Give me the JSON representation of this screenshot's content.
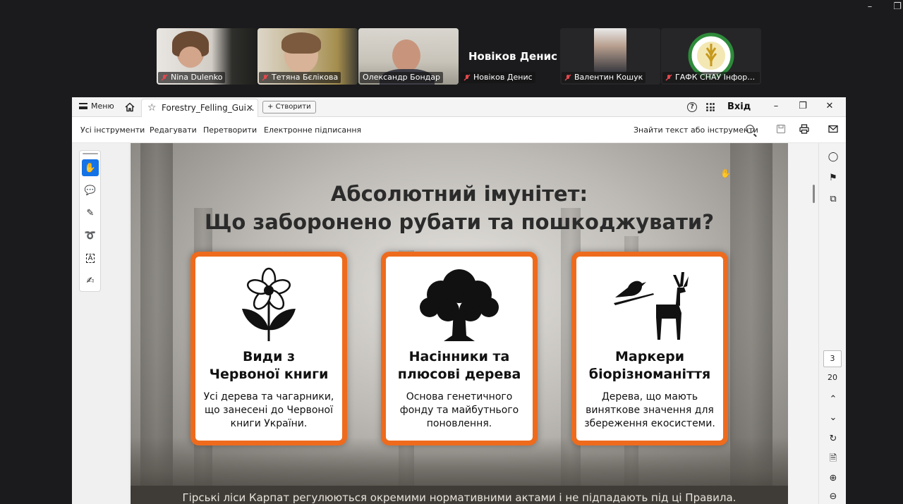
{
  "meeting": {
    "participants": [
      {
        "name": "Nina Dulenko"
      },
      {
        "name": "Тетяна Бєлікова"
      },
      {
        "name": "Олександр Бондар"
      },
      {
        "name": "Новіков Денис"
      },
      {
        "name": "Валентин Кошук"
      },
      {
        "name": "ГАФК СНАУ Інформац..."
      }
    ],
    "active_speaker_big_name": "Новіков Денис",
    "colors": {
      "active_border": "#3fd16b"
    }
  },
  "acrobat": {
    "menu_label": "Меню",
    "tab_title": "Forestry_Felling_Gui...",
    "create_label": "Створити",
    "signin_label": "Вхід",
    "toolbar": {
      "all_tools": "Усі інструменти",
      "edit": "Редагувати",
      "convert": "Перетворити",
      "esign": "Електронне підписання",
      "find": "Знайти текст або інструменти"
    },
    "page_current": "3",
    "page_total": "20",
    "colors": {
      "accent": "#1473e6",
      "card_border": "#ee6b1d"
    }
  },
  "slide": {
    "title_line1": "Абсолютний імунітет:",
    "title_line2": "Що заборонено рубати та пошкоджувати?",
    "cards": [
      {
        "icon": "flower-icon",
        "title_line1": "Види з",
        "title_line2": "Червоної книги",
        "desc": "Усі дерева та чагарники, що занесені до Червоної книги України."
      },
      {
        "icon": "oak-tree-icon",
        "title_line1": "Насінники та",
        "title_line2": "плюсові дерева",
        "desc": "Основа генетичного фонду та майбутнього поновлення."
      },
      {
        "icon": "bird-deer-icon",
        "title_line1": "Маркери",
        "title_line2": "біорізноманіття",
        "desc": "Дерева, що мають виняткове значення для збереження екосистеми."
      }
    ],
    "footer": "Гірські ліси Карпат регулюються окремими нормативними актами і не підпадають під ці Правила."
  }
}
